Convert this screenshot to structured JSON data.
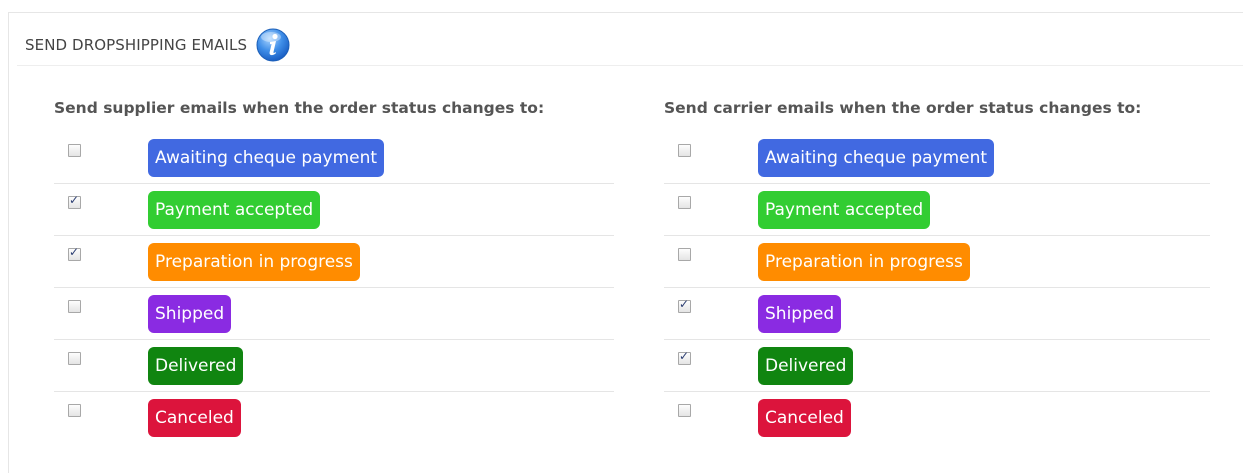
{
  "panel": {
    "title": "SEND DROPSHIPPING EMAILS",
    "info_icon": "info-icon"
  },
  "supplier": {
    "heading": "Send supplier emails when the order status changes to:",
    "statuses": [
      {
        "label": "Awaiting cheque payment",
        "checked": false,
        "color": "#4169e1"
      },
      {
        "label": "Payment accepted",
        "checked": true,
        "color": "#32cd32"
      },
      {
        "label": "Preparation in progress",
        "checked": true,
        "color": "#ff8c00"
      },
      {
        "label": "Shipped",
        "checked": false,
        "color": "#8a2be2"
      },
      {
        "label": "Delivered",
        "checked": false,
        "color": "#108510"
      },
      {
        "label": "Canceled",
        "checked": false,
        "color": "#dc143c"
      }
    ]
  },
  "carrier": {
    "heading": "Send carrier emails when the order status changes to:",
    "statuses": [
      {
        "label": "Awaiting cheque payment",
        "checked": false,
        "color": "#4169e1"
      },
      {
        "label": "Payment accepted",
        "checked": false,
        "color": "#32cd32"
      },
      {
        "label": "Preparation in progress",
        "checked": false,
        "color": "#ff8c00"
      },
      {
        "label": "Shipped",
        "checked": true,
        "color": "#8a2be2"
      },
      {
        "label": "Delivered",
        "checked": true,
        "color": "#108510"
      },
      {
        "label": "Canceled",
        "checked": false,
        "color": "#dc143c"
      }
    ]
  }
}
